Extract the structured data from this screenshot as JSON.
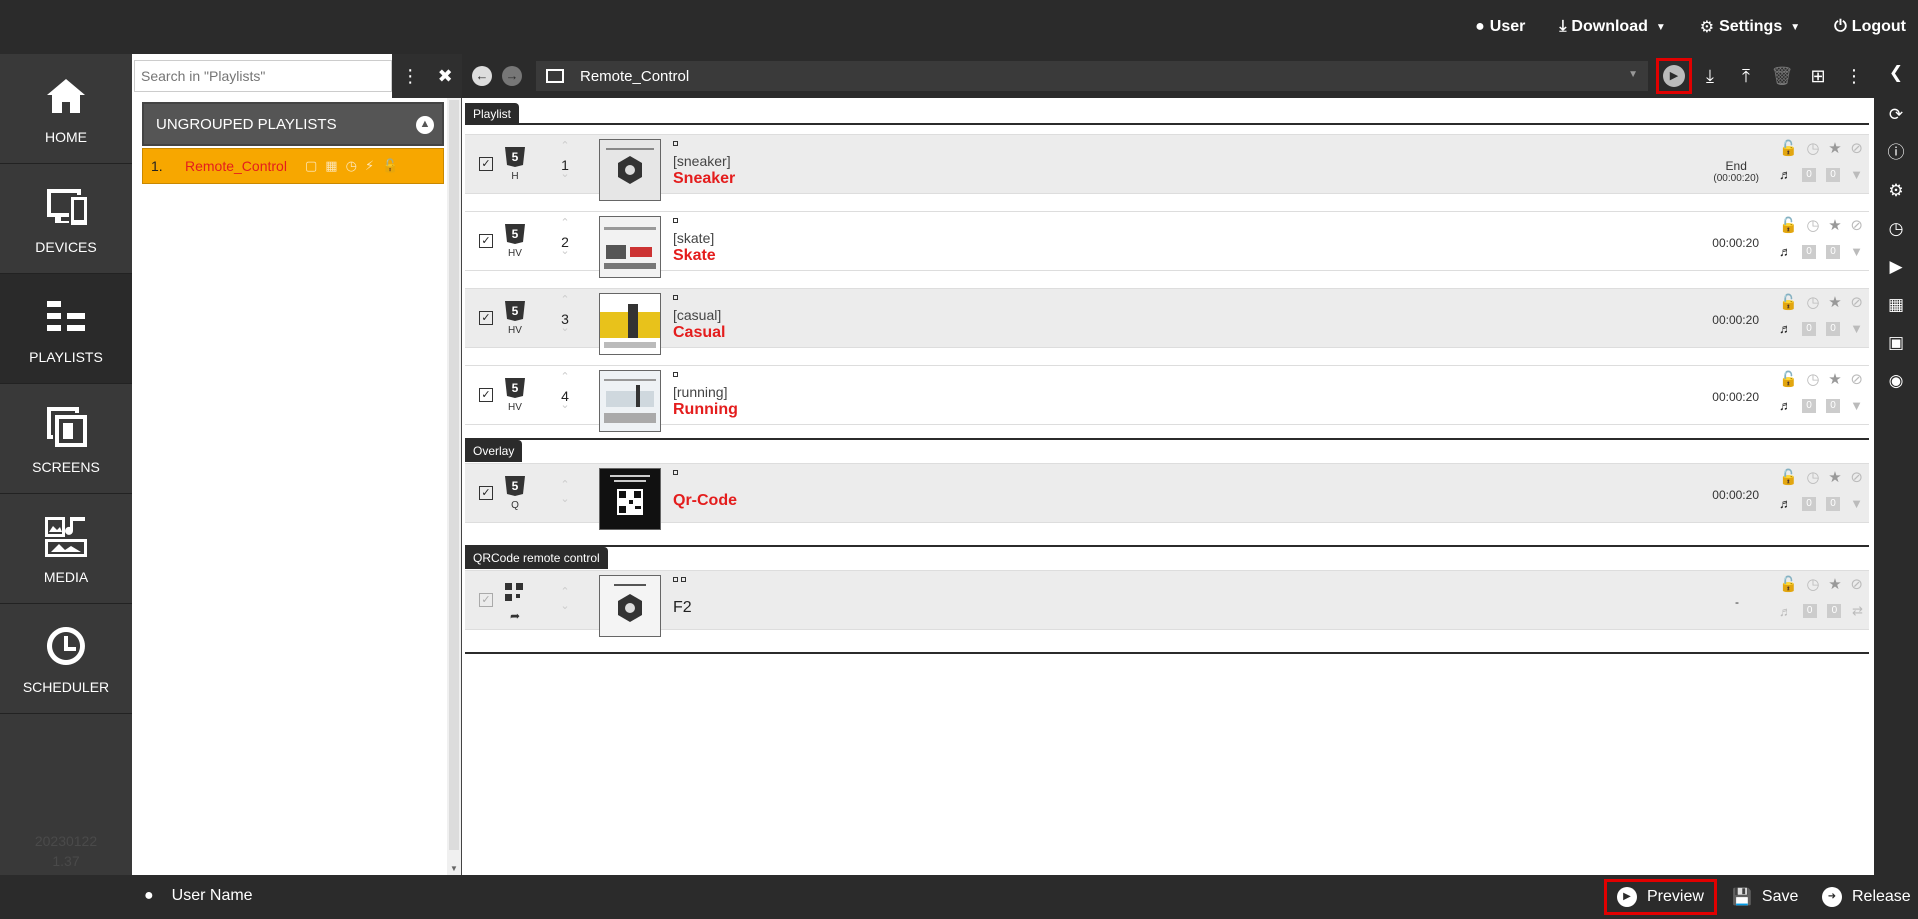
{
  "topnav": {
    "user": "User",
    "download": "Download",
    "settings": "Settings",
    "logout": "Logout"
  },
  "leftnav": {
    "home": "HOME",
    "devices": "DEVICES",
    "playlists": "PLAYLISTS",
    "screens": "SCREENS",
    "media": "MEDIA",
    "scheduler": "SCHEDULER",
    "version_line1": "20230122",
    "version_line2": "1.37"
  },
  "playlist_panel": {
    "search_placeholder": "Search in \"Playlists\"",
    "group_title": "UNGROUPED PLAYLISTS",
    "items": [
      {
        "num": "1.",
        "name": "Remote_Control"
      }
    ]
  },
  "main": {
    "playlist_name": "Remote_Control",
    "sections": {
      "playlist": "Playlist",
      "overlay": "Overlay",
      "qrcode": "QRCode remote control"
    },
    "playlist_rows": [
      {
        "index": "1",
        "sub": "H",
        "tag": "[sneaker]",
        "title": "Sneaker",
        "duration_top": "End",
        "duration_bottom": "(00:00:20)"
      },
      {
        "index": "2",
        "sub": "HV",
        "tag": "[skate]",
        "title": "Skate",
        "duration_top": "00:00:20",
        "duration_bottom": ""
      },
      {
        "index": "3",
        "sub": "HV",
        "tag": "[casual]",
        "title": "Casual",
        "duration_top": "00:00:20",
        "duration_bottom": ""
      },
      {
        "index": "4",
        "sub": "HV",
        "tag": "[running]",
        "title": "Running",
        "duration_top": "00:00:20",
        "duration_bottom": ""
      }
    ],
    "overlay_row": {
      "sub": "Q",
      "title": "Qr-Code",
      "duration": "00:00:20"
    },
    "qr_row": {
      "title": "F2",
      "duration": "-"
    },
    "counter_zero": "0"
  },
  "bottombar": {
    "user_name": "User Name",
    "preview": "Preview",
    "save": "Save",
    "release": "Release"
  }
}
